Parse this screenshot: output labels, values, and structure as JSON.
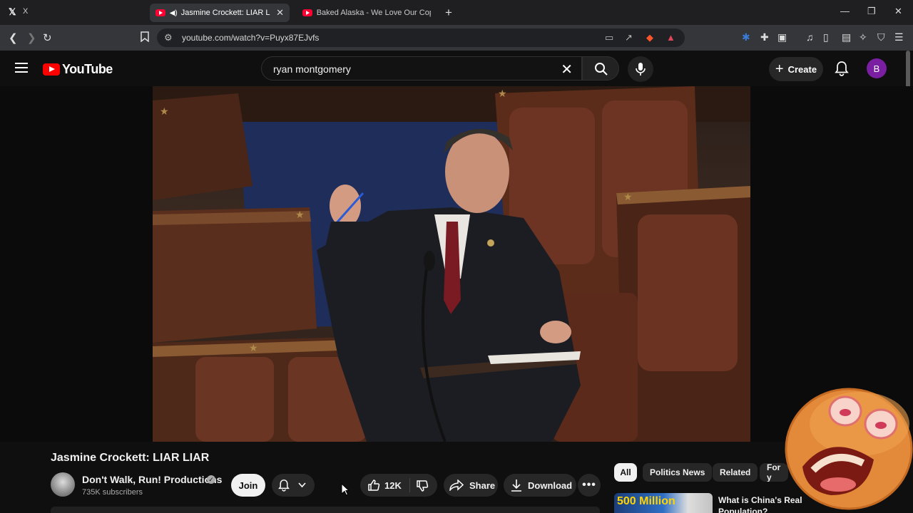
{
  "browser": {
    "pinned_tab_title": "X",
    "tabs": [
      {
        "title": "Jasmine Crockett: LIAR LIAR -",
        "active": true
      },
      {
        "title": "Baked Alaska - We Love Our Cops [LI",
        "active": false
      }
    ],
    "url": "youtube.com/watch?v=Puyx87EJvfs"
  },
  "youtube": {
    "logo_text": "YouTube",
    "search_query": "ryan montgomery",
    "create_label": "Create",
    "avatar_letter": "B"
  },
  "video": {
    "title": "Jasmine Crockett: LIAR LIAR",
    "channel": "Don't Walk, Run! Productions",
    "subscribers": "735K subscribers",
    "join_label": "Join",
    "likes": "12K",
    "share_label": "Share",
    "download_label": "Download"
  },
  "chips": [
    "All",
    "Politics News",
    "Related",
    "For y"
  ],
  "recommendation": {
    "thumb_text": "500 Million",
    "title": "What is China's Real Population?"
  },
  "colors": {
    "youtube_red": "#ff0000",
    "background": "#0f0f0f",
    "avatar_purple": "#7b1fa2"
  }
}
